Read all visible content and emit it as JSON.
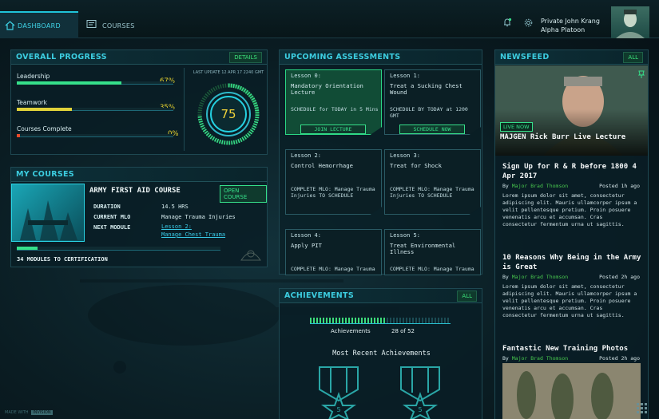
{
  "nav": {
    "dashboard": "DASHBOARD",
    "courses": "COURSES"
  },
  "user": {
    "name": "Private John Krang",
    "unit": "Alpha Platoon"
  },
  "progress": {
    "title": "OVERALL PROGRESS",
    "details_btn": "DETAILS",
    "last_update": "LAST UPDATE 12 APR 17 2240 GMT",
    "gauge_value": "75",
    "bars": [
      {
        "label": "Leadership",
        "pct": "67%",
        "value": 0.67,
        "color": "#36e08a"
      },
      {
        "label": "Teamwork",
        "pct": "35%",
        "value": 0.35,
        "color": "#e0d23a"
      },
      {
        "label": "Courses Complete",
        "pct": "0%",
        "value": 0.02,
        "color": "#e84a2a"
      }
    ]
  },
  "courses": {
    "title": "MY COURSES",
    "course_title": "ARMY FIRST AID COURSE",
    "open_btn": "OPEN COURSE",
    "duration_label": "DURATION",
    "duration": "14.5 HRS",
    "mlo_label": "CURRENT MLO",
    "mlo": "Manage Trauma Injuries",
    "next_label": "NEXT MODULE",
    "next_l1": "Lesson 2:",
    "next_l2": "Manage Chest Trauma",
    "modules": "34 MODULES TO CERTIFICATION",
    "module_progress": 0.1
  },
  "assessments": {
    "title": "UPCOMING ASSESSMENTS",
    "cards": [
      {
        "lesson": "Lesson 0:",
        "title": "Mandatory Orientation Lecture",
        "status": "SCHEDULE for TODAY in 5 Mins",
        "button": "JOIN LECTURE",
        "active": true
      },
      {
        "lesson": "Lesson 1:",
        "title": "Treat a Sucking Chest Wound",
        "status": "SCHEDULE BY TODAY at 1200 GMT",
        "button": "SCHEDULE NOW",
        "active": false
      },
      {
        "lesson": "Lesson 2:",
        "title": "Control Hemorrhage",
        "status": "COMPLETE MLO: Manage Trauma Injuries TO SCHEDULE",
        "button": "",
        "active": false
      },
      {
        "lesson": "Lesson 3:",
        "title": "Treat for Shock",
        "status": "COMPLETE MLO: Manage Trauma Injuries TO SCHEDULE",
        "button": "",
        "active": false
      },
      {
        "lesson": "Lesson 4:",
        "title": "Apply PIT",
        "status": "COMPLETE MLO: Manage Trauma",
        "button": "",
        "active": false
      },
      {
        "lesson": "Lesson 5:",
        "title": "Treat Environmental Illness",
        "status": "COMPLETE MLO: Manage Trauma",
        "button": "",
        "active": false
      }
    ]
  },
  "achievements": {
    "title": "ACHIEVEMENTS",
    "all_btn": "ALL",
    "label": "Achievements",
    "count": "28 of 52",
    "value": 0.54,
    "recent": "Most Recent Achievements",
    "medal1": "5",
    "medal2": "5"
  },
  "newsfeed": {
    "title": "NEWSFEED",
    "all_btn": "ALL",
    "live_badge": "LIVE NOW",
    "live_title": "MAJGEN Rick Burr Live Lecture",
    "items": [
      {
        "title": "Sign Up for R & R before 1800 4 Apr 2017",
        "by": "By ",
        "author": "Major Brad Thomson",
        "posted": "Posted 1h ago",
        "body": "Lorem ipsum dolor sit amet, consectetur adipiscing elit. Mauris ullamcorper ipsum a velit pellentesque pretium. Proin posuere venenatis arcu et accumsan. Cras consectetur fermentum urna ut sagittis."
      },
      {
        "title": "10 Reasons Why Being in the Army is Great",
        "by": "By ",
        "author": "Major Brad Thomson",
        "posted": "Posted 2h ago",
        "body": "Lorem ipsum dolor sit amet, consectetur adipiscing elit. Mauris ullamcorper ipsum a velit pellentesque pretium. Proin posuere venenatis arcu et accumsan. Cras consectetur fermentum urna ut sagittis."
      },
      {
        "title": "Fantastic New Training Photos",
        "by": "By ",
        "author": "Major Brad Thomson",
        "posted": "Posted 2h ago",
        "body": ""
      }
    ]
  },
  "footer": {
    "made_with": "MADE WITH",
    "brand": "INVISION"
  }
}
